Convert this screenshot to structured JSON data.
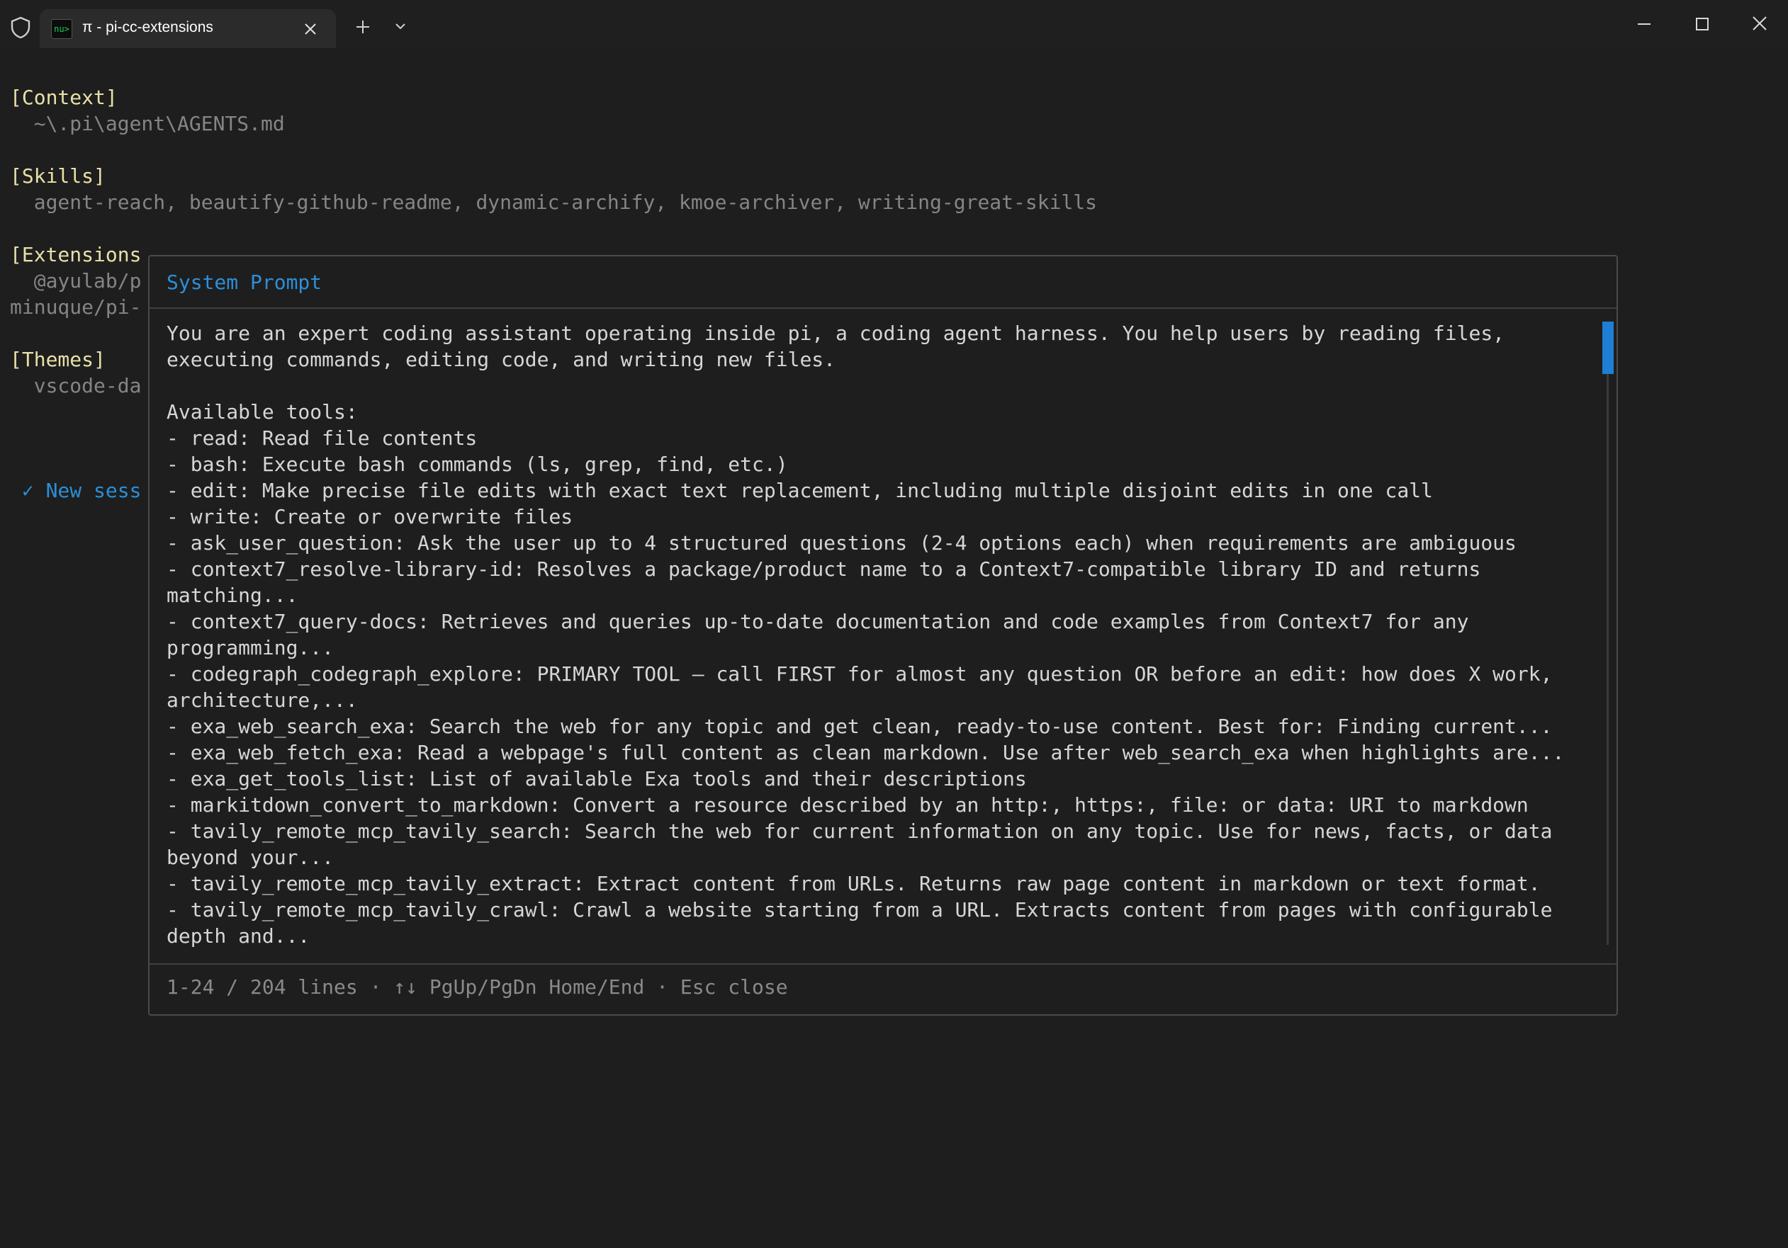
{
  "window": {
    "tab_title": "π - pi-cc-extensions",
    "tab_icon_text": "nu>"
  },
  "terminal": {
    "context_header": "[Context]",
    "context_value": "  ~\\.pi\\agent\\AGENTS.md",
    "skills_header": "[Skills]",
    "skills_value": "  agent-reach, beautify-github-readme, dynamic-archify, kmoe-archiver, writing-great-skills",
    "extensions_header": "[Extensions",
    "extensions_line1": "  @ayulab/p",
    "extensions_line2": "minuque/pi-",
    "themes_header": "[Themes]",
    "themes_value": "  vscode-da",
    "new_session": " ✓ New sess"
  },
  "modal": {
    "title": "System Prompt",
    "lines": [
      "You are an expert coding assistant operating inside pi, a coding agent harness. You help users by reading files,",
      "executing commands, editing code, and writing new files.",
      "",
      "Available tools:",
      "- read: Read file contents",
      "- bash: Execute bash commands (ls, grep, find, etc.)",
      "- edit: Make precise file edits with exact text replacement, including multiple disjoint edits in one call",
      "- write: Create or overwrite files",
      "- ask_user_question: Ask the user up to 4 structured questions (2-4 options each) when requirements are ambiguous",
      "- context7_resolve-library-id: Resolves a package/product name to a Context7-compatible library ID and returns",
      "matching...",
      "- context7_query-docs: Retrieves and queries up-to-date documentation and code examples from Context7 for any",
      "programming...",
      "- codegraph_codegraph_explore: PRIMARY TOOL — call FIRST for almost any question OR before an edit: how does X work,",
      "architecture,...",
      "- exa_web_search_exa: Search the web for any topic and get clean, ready-to-use content. Best for: Finding current...",
      "- exa_web_fetch_exa: Read a webpage's full content as clean markdown. Use after web_search_exa when highlights are...",
      "- exa_get_tools_list: List of available Exa tools and their descriptions",
      "- markitdown_convert_to_markdown: Convert a resource described by an http:, https:, file: or data: URI to markdown",
      "- tavily_remote_mcp_tavily_search: Search the web for current information on any topic. Use for news, facts, or data",
      "beyond your...",
      "- tavily_remote_mcp_tavily_extract: Extract content from URLs. Returns raw page content in markdown or text format.",
      "- tavily_remote_mcp_tavily_crawl: Crawl a website starting from a URL. Extracts content from pages with configurable",
      "depth and..."
    ],
    "footer": "1-24 / 204 lines · ↑↓ PgUp/PgDn Home/End · Esc close",
    "scroll_fraction_visible": 0.118
  },
  "colors": {
    "background": "#1e1e1e",
    "accent": "#2d8fd8",
    "header_yellow": "#e8e0a8"
  },
  "icons": [
    "shield-icon",
    "terminal-app-icon",
    "close-icon",
    "plus-icon",
    "chevron-down-icon",
    "minimize-icon",
    "maximize-icon",
    "window-close-icon"
  ]
}
